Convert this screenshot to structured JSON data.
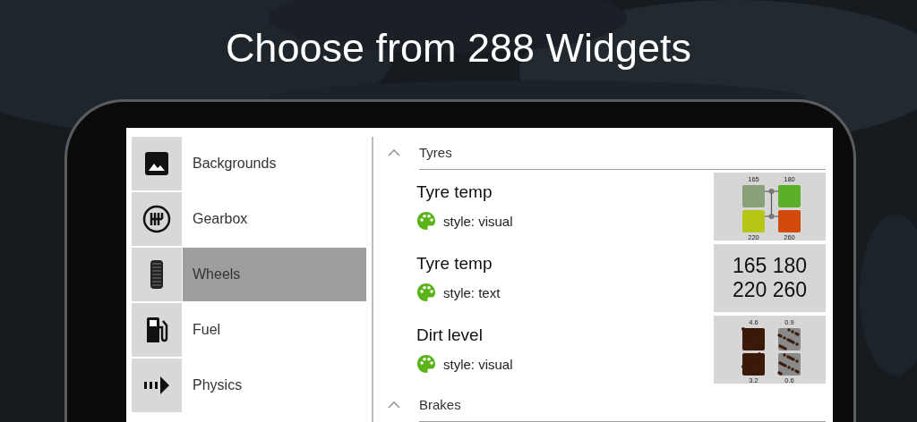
{
  "headline": "Choose from 288 Widgets",
  "categories": [
    {
      "label": "Backgrounds",
      "selected": false
    },
    {
      "label": "Gearbox",
      "selected": false
    },
    {
      "label": "Wheels",
      "selected": true
    },
    {
      "label": "Fuel",
      "selected": false
    },
    {
      "label": "Physics",
      "selected": false
    }
  ],
  "sections": [
    {
      "title": "Tyres",
      "expanded": true,
      "widgets": [
        {
          "name": "Tyre temp",
          "style": "style: visual",
          "preview": {
            "kind": "tyre_visual",
            "tyres": [
              {
                "value": "165",
                "color": "#8aa07a"
              },
              {
                "value": "180",
                "color": "#5bb02a"
              },
              {
                "value": "220",
                "color": "#b5c614"
              },
              {
                "value": "260",
                "color": "#d24a0a"
              }
            ]
          }
        },
        {
          "name": "Tyre temp",
          "style": "style: text",
          "preview": {
            "kind": "text",
            "lines": [
              "165 180",
              "220 260"
            ]
          }
        },
        {
          "name": "Dirt level",
          "style": "style: visual",
          "preview": {
            "kind": "dirt_visual",
            "tyres": [
              {
                "value": "4.6",
                "kind": "heavy"
              },
              {
                "value": "0.9",
                "kind": "light"
              },
              {
                "value": "3.2",
                "kind": "heavy"
              },
              {
                "value": "0.6",
                "kind": "light"
              }
            ]
          }
        }
      ]
    },
    {
      "title": "Brakes",
      "expanded": true
    }
  ]
}
